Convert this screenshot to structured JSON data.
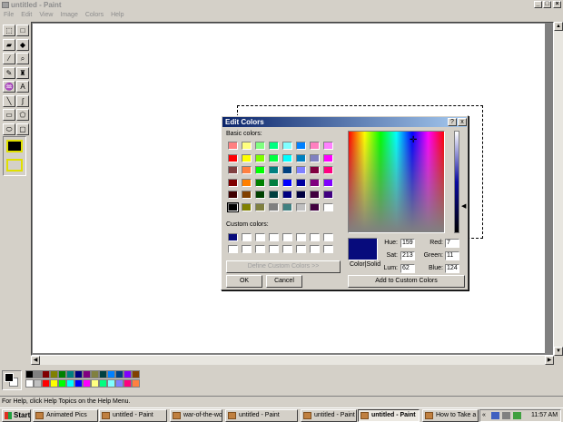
{
  "window": {
    "title": "untitled - Paint"
  },
  "menu": [
    "File",
    "Edit",
    "View",
    "Image",
    "Colors",
    "Help"
  ],
  "tools": [
    {
      "name": "free-form-select-tool",
      "glyph": "⬚"
    },
    {
      "name": "rect-select-tool",
      "glyph": "□"
    },
    {
      "name": "eraser-tool",
      "glyph": "▰"
    },
    {
      "name": "fill-tool",
      "glyph": "◆"
    },
    {
      "name": "pick-color-tool",
      "glyph": "⁄"
    },
    {
      "name": "magnifier-tool",
      "glyph": "⌕"
    },
    {
      "name": "pencil-tool",
      "glyph": "✎"
    },
    {
      "name": "brush-tool",
      "glyph": "♜"
    },
    {
      "name": "airbrush-tool",
      "glyph": "♒"
    },
    {
      "name": "text-tool",
      "glyph": "A"
    },
    {
      "name": "line-tool",
      "glyph": "╲"
    },
    {
      "name": "curve-tool",
      "glyph": "∫"
    },
    {
      "name": "rectangle-tool",
      "glyph": "▭"
    },
    {
      "name": "polygon-tool",
      "glyph": "⬠"
    },
    {
      "name": "ellipse-tool",
      "glyph": "⬭"
    },
    {
      "name": "rounded-rect-tool",
      "glyph": "▢"
    }
  ],
  "palette": {
    "row1": [
      "#000000",
      "#808080",
      "#800000",
      "#808000",
      "#008000",
      "#008080",
      "#000080",
      "#800080",
      "#808040",
      "#004040",
      "#0080ff",
      "#004080",
      "#8000ff",
      "#804000"
    ],
    "row2": [
      "#ffffff",
      "#c0c0c0",
      "#ff0000",
      "#ffff00",
      "#00ff00",
      "#00ffff",
      "#0000ff",
      "#ff00ff",
      "#ffff80",
      "#00ff80",
      "#80ffff",
      "#8080ff",
      "#ff0080",
      "#ff8040"
    ]
  },
  "status": {
    "text": "For Help, click Help Topics on the Help Menu."
  },
  "taskbar": {
    "start": "Start",
    "items": [
      {
        "label": "Animated Pics",
        "active": false
      },
      {
        "label": "untitled - Paint",
        "active": false
      },
      {
        "label": "war-of-the-wor...",
        "active": false
      },
      {
        "label": "untitled - Paint",
        "active": false
      },
      {
        "label": "untitled - Paint",
        "active": false
      },
      {
        "label": "untitled - Paint",
        "active": true
      },
      {
        "label": "How to Take a ...",
        "active": false
      }
    ],
    "clock": "11:57 AM",
    "tray_arrows": "«"
  },
  "dialog": {
    "title": "Edit Colors",
    "help": "?",
    "close": "x",
    "basic_label": "Basic colors:",
    "custom_label": "Custom colors:",
    "define_btn": "Define Custom Colors >>",
    "ok": "OK",
    "cancel": "Cancel",
    "add_btn": "Add to Custom Colors",
    "colorsolid": "Color|Solid",
    "hue_label": "Hue:",
    "hue": "159",
    "sat_label": "Sat:",
    "sat": "213",
    "lum_label": "Lum:",
    "lum": "62",
    "red_label": "Red:",
    "red": "7",
    "green_label": "Green:",
    "green": "11",
    "blue_label": "Blue:",
    "blue": "124",
    "current_color": "#070b7c",
    "basic": [
      "#ff8080",
      "#ffff80",
      "#80ff80",
      "#00ff80",
      "#80ffff",
      "#0080ff",
      "#ff80c0",
      "#ff80ff",
      "#ff0000",
      "#ffff00",
      "#80ff00",
      "#00ff40",
      "#00ffff",
      "#0080c0",
      "#8080c0",
      "#ff00ff",
      "#804040",
      "#ff8040",
      "#00ff00",
      "#008080",
      "#004080",
      "#8080ff",
      "#800040",
      "#ff0080",
      "#800000",
      "#ff8000",
      "#008000",
      "#008040",
      "#0000ff",
      "#0000a0",
      "#800080",
      "#8000ff",
      "#400000",
      "#804000",
      "#004000",
      "#004040",
      "#000080",
      "#000040",
      "#400040",
      "#400080",
      "#000000",
      "#808000",
      "#808040",
      "#808080",
      "#408080",
      "#c0c0c0",
      "#400040",
      "#ffffff"
    ],
    "custom": [
      "#070b7c",
      "#ffffff",
      "#ffffff",
      "#ffffff",
      "#ffffff",
      "#ffffff",
      "#ffffff",
      "#ffffff",
      "#ffffff",
      "#ffffff",
      "#ffffff",
      "#ffffff",
      "#ffffff",
      "#ffffff",
      "#ffffff",
      "#ffffff"
    ]
  }
}
